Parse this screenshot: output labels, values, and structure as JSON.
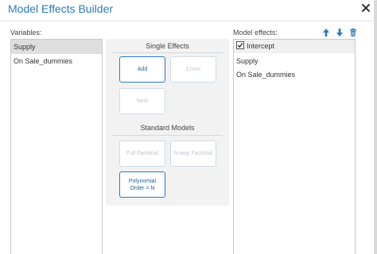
{
  "dialog": {
    "title": "Model Effects Builder",
    "close_icon": "close-icon"
  },
  "variables": {
    "label": "Variables:",
    "items": [
      "Supply",
      "On Sale_dummies"
    ],
    "selected": "Supply"
  },
  "single_effects": {
    "heading": "Single Effects",
    "add_label": "Add",
    "cross_label": "Cross",
    "nest_label": "Nest"
  },
  "standard_models": {
    "heading": "Standard Models",
    "full_factorial_label": "Full Factorial",
    "nway_factorial_label": "N-way Factorial",
    "polynomial_label": "Polynomial Order = N"
  },
  "model_effects": {
    "label": "Model effects:",
    "intercept_label": "Intercept",
    "intercept_checked": true,
    "items": [
      "Supply",
      "On Sale_dummies"
    ],
    "icons": [
      "arrow-up-icon",
      "arrow-down-icon",
      "trash-icon"
    ]
  },
  "colors": {
    "title": "#2b7bb9",
    "button_border": "#2b7bb9",
    "selected_row": "#dedede",
    "panel_bg": "#f2f2f2"
  }
}
